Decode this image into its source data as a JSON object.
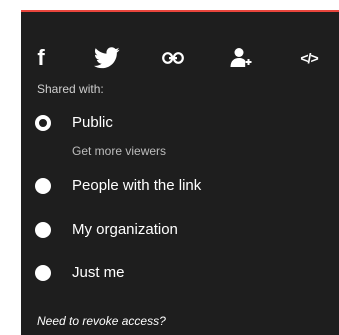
{
  "colors": {
    "panel_background": "#1e1e1e",
    "text": "#ffffff",
    "muted_text": "#cfcfcf",
    "accent": "#e8453c"
  },
  "share_buttons": [
    {
      "icon": "facebook-icon"
    },
    {
      "icon": "twitter-icon"
    },
    {
      "icon": "link-icon"
    },
    {
      "icon": "add-user-icon"
    },
    {
      "icon": "embed-code-icon"
    }
  ],
  "labels": {
    "facebook_glyph": "f",
    "embed_glyph": "</>"
  },
  "shared_with": {
    "heading": "Shared with:",
    "selected": "Public",
    "options": [
      {
        "label": "Public",
        "sub": "Get more viewers",
        "selected": true
      },
      {
        "label": "People with the link",
        "selected": false
      },
      {
        "label": "My organization",
        "selected": false
      },
      {
        "label": "Just me",
        "selected": false
      }
    ]
  },
  "revoke": {
    "label": "Need to revoke access?"
  }
}
